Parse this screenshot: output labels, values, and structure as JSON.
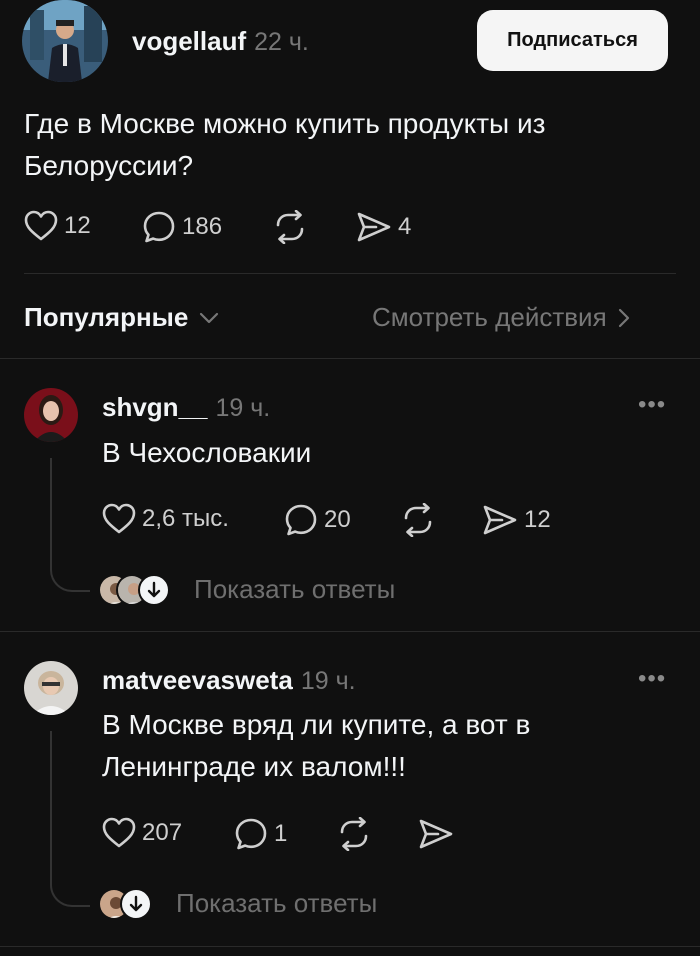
{
  "post": {
    "username": "vogellauf",
    "time": "22 ч.",
    "follow_label": "Подписаться",
    "text_line1": "Где в Москве можно купить продукты из",
    "text_line2": "Белоруссии?",
    "likes": "12",
    "comments": "186",
    "shares": "4"
  },
  "sort": {
    "label": "Популярные",
    "view_activity": "Смотреть действия"
  },
  "replies": [
    {
      "username": "shvgn__",
      "time": "19 ч.",
      "text_line1": "В Чехословакии",
      "text_line2": "",
      "likes": "2,6 тыс.",
      "comments": "20",
      "shares": "12",
      "show_replies": "Показать ответы"
    },
    {
      "username": "matveevasweta",
      "time": "19 ч.",
      "text_line1": "В Москве вряд ли купите, а вот в",
      "text_line2": "Ленинграде их валом!!!",
      "likes": "207",
      "comments": "1",
      "shares": "",
      "show_replies": "Показать ответы"
    }
  ],
  "icons": {
    "like": "heart-icon",
    "comment": "comment-bubble-icon",
    "repost": "repost-icon",
    "share": "send-icon",
    "more": "more-dots-icon",
    "chevron_down": "chevron-down-icon",
    "chevron_right": "chevron-right-icon",
    "arrow_down": "arrow-down-icon"
  },
  "colors": {
    "background": "#101010",
    "text": "#f3f5f7",
    "muted": "#777777",
    "button_bg": "#f5f5f5"
  }
}
